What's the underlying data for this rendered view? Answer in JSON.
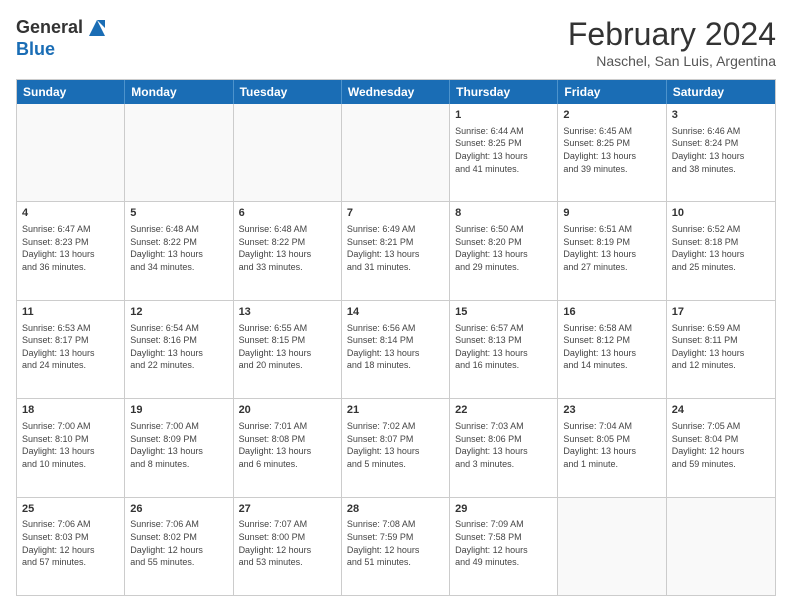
{
  "header": {
    "logo_general": "General",
    "logo_blue": "Blue",
    "title": "February 2024",
    "location": "Naschel, San Luis, Argentina"
  },
  "weekdays": [
    "Sunday",
    "Monday",
    "Tuesday",
    "Wednesday",
    "Thursday",
    "Friday",
    "Saturday"
  ],
  "rows": [
    [
      {
        "day": "",
        "info": ""
      },
      {
        "day": "",
        "info": ""
      },
      {
        "day": "",
        "info": ""
      },
      {
        "day": "",
        "info": ""
      },
      {
        "day": "1",
        "info": "Sunrise: 6:44 AM\nSunset: 8:25 PM\nDaylight: 13 hours\nand 41 minutes."
      },
      {
        "day": "2",
        "info": "Sunrise: 6:45 AM\nSunset: 8:25 PM\nDaylight: 13 hours\nand 39 minutes."
      },
      {
        "day": "3",
        "info": "Sunrise: 6:46 AM\nSunset: 8:24 PM\nDaylight: 13 hours\nand 38 minutes."
      }
    ],
    [
      {
        "day": "4",
        "info": "Sunrise: 6:47 AM\nSunset: 8:23 PM\nDaylight: 13 hours\nand 36 minutes."
      },
      {
        "day": "5",
        "info": "Sunrise: 6:48 AM\nSunset: 8:22 PM\nDaylight: 13 hours\nand 34 minutes."
      },
      {
        "day": "6",
        "info": "Sunrise: 6:48 AM\nSunset: 8:22 PM\nDaylight: 13 hours\nand 33 minutes."
      },
      {
        "day": "7",
        "info": "Sunrise: 6:49 AM\nSunset: 8:21 PM\nDaylight: 13 hours\nand 31 minutes."
      },
      {
        "day": "8",
        "info": "Sunrise: 6:50 AM\nSunset: 8:20 PM\nDaylight: 13 hours\nand 29 minutes."
      },
      {
        "day": "9",
        "info": "Sunrise: 6:51 AM\nSunset: 8:19 PM\nDaylight: 13 hours\nand 27 minutes."
      },
      {
        "day": "10",
        "info": "Sunrise: 6:52 AM\nSunset: 8:18 PM\nDaylight: 13 hours\nand 25 minutes."
      }
    ],
    [
      {
        "day": "11",
        "info": "Sunrise: 6:53 AM\nSunset: 8:17 PM\nDaylight: 13 hours\nand 24 minutes."
      },
      {
        "day": "12",
        "info": "Sunrise: 6:54 AM\nSunset: 8:16 PM\nDaylight: 13 hours\nand 22 minutes."
      },
      {
        "day": "13",
        "info": "Sunrise: 6:55 AM\nSunset: 8:15 PM\nDaylight: 13 hours\nand 20 minutes."
      },
      {
        "day": "14",
        "info": "Sunrise: 6:56 AM\nSunset: 8:14 PM\nDaylight: 13 hours\nand 18 minutes."
      },
      {
        "day": "15",
        "info": "Sunrise: 6:57 AM\nSunset: 8:13 PM\nDaylight: 13 hours\nand 16 minutes."
      },
      {
        "day": "16",
        "info": "Sunrise: 6:58 AM\nSunset: 8:12 PM\nDaylight: 13 hours\nand 14 minutes."
      },
      {
        "day": "17",
        "info": "Sunrise: 6:59 AM\nSunset: 8:11 PM\nDaylight: 13 hours\nand 12 minutes."
      }
    ],
    [
      {
        "day": "18",
        "info": "Sunrise: 7:00 AM\nSunset: 8:10 PM\nDaylight: 13 hours\nand 10 minutes."
      },
      {
        "day": "19",
        "info": "Sunrise: 7:00 AM\nSunset: 8:09 PM\nDaylight: 13 hours\nand 8 minutes."
      },
      {
        "day": "20",
        "info": "Sunrise: 7:01 AM\nSunset: 8:08 PM\nDaylight: 13 hours\nand 6 minutes."
      },
      {
        "day": "21",
        "info": "Sunrise: 7:02 AM\nSunset: 8:07 PM\nDaylight: 13 hours\nand 5 minutes."
      },
      {
        "day": "22",
        "info": "Sunrise: 7:03 AM\nSunset: 8:06 PM\nDaylight: 13 hours\nand 3 minutes."
      },
      {
        "day": "23",
        "info": "Sunrise: 7:04 AM\nSunset: 8:05 PM\nDaylight: 13 hours\nand 1 minute."
      },
      {
        "day": "24",
        "info": "Sunrise: 7:05 AM\nSunset: 8:04 PM\nDaylight: 12 hours\nand 59 minutes."
      }
    ],
    [
      {
        "day": "25",
        "info": "Sunrise: 7:06 AM\nSunset: 8:03 PM\nDaylight: 12 hours\nand 57 minutes."
      },
      {
        "day": "26",
        "info": "Sunrise: 7:06 AM\nSunset: 8:02 PM\nDaylight: 12 hours\nand 55 minutes."
      },
      {
        "day": "27",
        "info": "Sunrise: 7:07 AM\nSunset: 8:00 PM\nDaylight: 12 hours\nand 53 minutes."
      },
      {
        "day": "28",
        "info": "Sunrise: 7:08 AM\nSunset: 7:59 PM\nDaylight: 12 hours\nand 51 minutes."
      },
      {
        "day": "29",
        "info": "Sunrise: 7:09 AM\nSunset: 7:58 PM\nDaylight: 12 hours\nand 49 minutes."
      },
      {
        "day": "",
        "info": ""
      },
      {
        "day": "",
        "info": ""
      }
    ]
  ]
}
